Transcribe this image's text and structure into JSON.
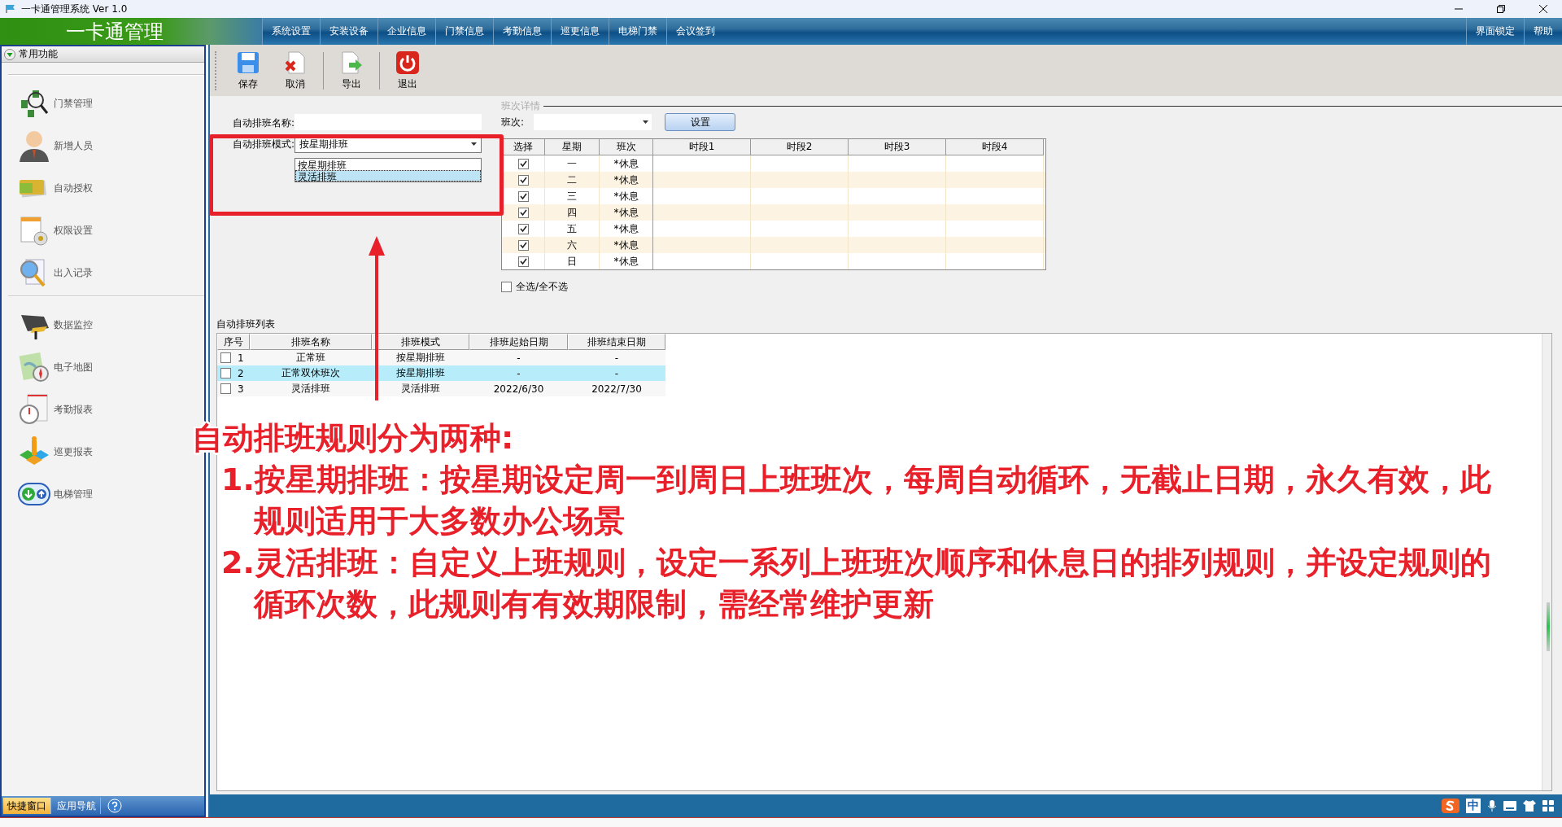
{
  "window": {
    "title": "一卡通管理系统  Ver 1.0"
  },
  "app_banner": {
    "title": "一卡通管理"
  },
  "menu": [
    {
      "label": "系统设置"
    },
    {
      "label": "安装设备"
    },
    {
      "label": "企业信息"
    },
    {
      "label": "门禁信息"
    },
    {
      "label": "考勤信息"
    },
    {
      "label": "巡更信息"
    },
    {
      "label": "电梯门禁"
    },
    {
      "label": "会议签到"
    }
  ],
  "menu_right": [
    {
      "label": "界面锁定"
    },
    {
      "label": "帮助"
    }
  ],
  "sidebar": {
    "header": "常用功能",
    "expanded": true,
    "groups": [
      [
        {
          "label": "门禁管理"
        },
        {
          "label": "新增人员"
        },
        {
          "label": "自动授权"
        },
        {
          "label": "权限设置"
        },
        {
          "label": "出入记录"
        }
      ],
      [
        {
          "label": "数据监控"
        },
        {
          "label": "电子地图"
        },
        {
          "label": "考勤报表"
        },
        {
          "label": "巡更报表"
        },
        {
          "label": "电梯管理"
        }
      ]
    ],
    "tabs": [
      {
        "label": "快捷窗口",
        "selected": true
      },
      {
        "label": "应用导航",
        "selected": false
      }
    ]
  },
  "toolbar": [
    {
      "label": "保存"
    },
    {
      "label": "取消"
    },
    {
      "label": "导出"
    },
    {
      "label": "退出"
    }
  ],
  "form": {
    "name_label": "自动排班名称:",
    "mode_label": "自动排班模式:",
    "mode_value": "按星期排班",
    "mode_options": [
      {
        "label": "按星期排班",
        "selected": false
      },
      {
        "label": "灵活排班",
        "selected": true
      }
    ]
  },
  "shift_details": {
    "title": "班次详情",
    "shift_label": "班次:",
    "set_button": "设置",
    "columns": [
      "选择",
      "星期",
      "班次",
      "时段1",
      "时段2",
      "时段3",
      "时段4"
    ],
    "rows": [
      {
        "checked": true,
        "day": "一",
        "shift": "*休息"
      },
      {
        "checked": true,
        "day": "二",
        "shift": "*休息"
      },
      {
        "checked": true,
        "day": "三",
        "shift": "*休息"
      },
      {
        "checked": true,
        "day": "四",
        "shift": "*休息"
      },
      {
        "checked": true,
        "day": "五",
        "shift": "*休息"
      },
      {
        "checked": true,
        "day": "六",
        "shift": "*休息"
      },
      {
        "checked": true,
        "day": "日",
        "shift": "*休息"
      }
    ],
    "select_all": {
      "label": "全选/全不选",
      "checked": false
    }
  },
  "schedule_list": {
    "title": "自动排班列表",
    "columns": [
      "序号",
      "排班名称",
      "排班模式",
      "排班起始日期",
      "排班结束日期"
    ],
    "rows": [
      {
        "checked": false,
        "selected": false,
        "cells": [
          "1",
          "正常班",
          "按星期排班",
          "-",
          "-"
        ]
      },
      {
        "checked": false,
        "selected": true,
        "cells": [
          "2",
          "正常双休班次",
          "按星期排班",
          "-",
          "-"
        ]
      },
      {
        "checked": false,
        "selected": false,
        "cells": [
          "3",
          "灵活排班",
          "灵活排班",
          "2022/6/30",
          "2022/7/30"
        ]
      }
    ]
  },
  "annotation": {
    "heading": "自动排班规则分为两种:",
    "points": [
      "1.按星期排班：按星期设定周一到周日上班班次，每周自动循环，无截止日期，永久有效，此规则适用于大多数办公场景",
      "2.灵活排班：自定义上班规则，设定一系列上班班次顺序和休息日的排列规则，并设定规则的循环次数，此规则有有效期限制，需经常维护更新"
    ]
  },
  "ime_bar": {
    "label": "中"
  }
}
